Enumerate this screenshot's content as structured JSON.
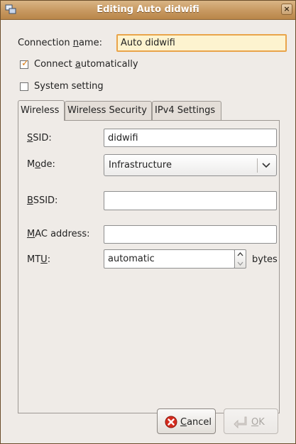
{
  "window": {
    "title": "Editing Auto didwifi"
  },
  "connection": {
    "name_label_pre": "Connection ",
    "name_label_u": "n",
    "name_label_post": "ame:",
    "name_value": "Auto didwifi"
  },
  "options": {
    "connect_auto_pre": "Connect ",
    "connect_auto_u": "a",
    "connect_auto_post": "utomatically",
    "connect_auto_checked": true,
    "system_setting": "System setting",
    "system_setting_checked": false
  },
  "tabs": [
    {
      "label": "Wireless",
      "active": true
    },
    {
      "label": "Wireless Security",
      "active": false
    },
    {
      "label": "IPv4 Settings",
      "active": false
    }
  ],
  "wireless": {
    "ssid_u": "S",
    "ssid_rest": "SID:",
    "ssid_value": "didwifi",
    "mode_pre": "M",
    "mode_u": "o",
    "mode_post": "de:",
    "mode_value": "Infrastructure",
    "bssid_u": "B",
    "bssid_rest": "SSID:",
    "bssid_value": "",
    "mac_u": "M",
    "mac_rest": "AC address:",
    "mac_value": "",
    "mtu_pre": "MT",
    "mtu_u": "U",
    "mtu_post": ":",
    "mtu_value": "automatic",
    "mtu_unit": "bytes"
  },
  "buttons": {
    "cancel_u": "C",
    "cancel_rest": "ancel",
    "ok_u": "O",
    "ok_rest": "K"
  },
  "colors": {
    "titlebar": "#c79860",
    "focus_border": "#e9a44a",
    "cancel_icon": "#d52b1e"
  }
}
